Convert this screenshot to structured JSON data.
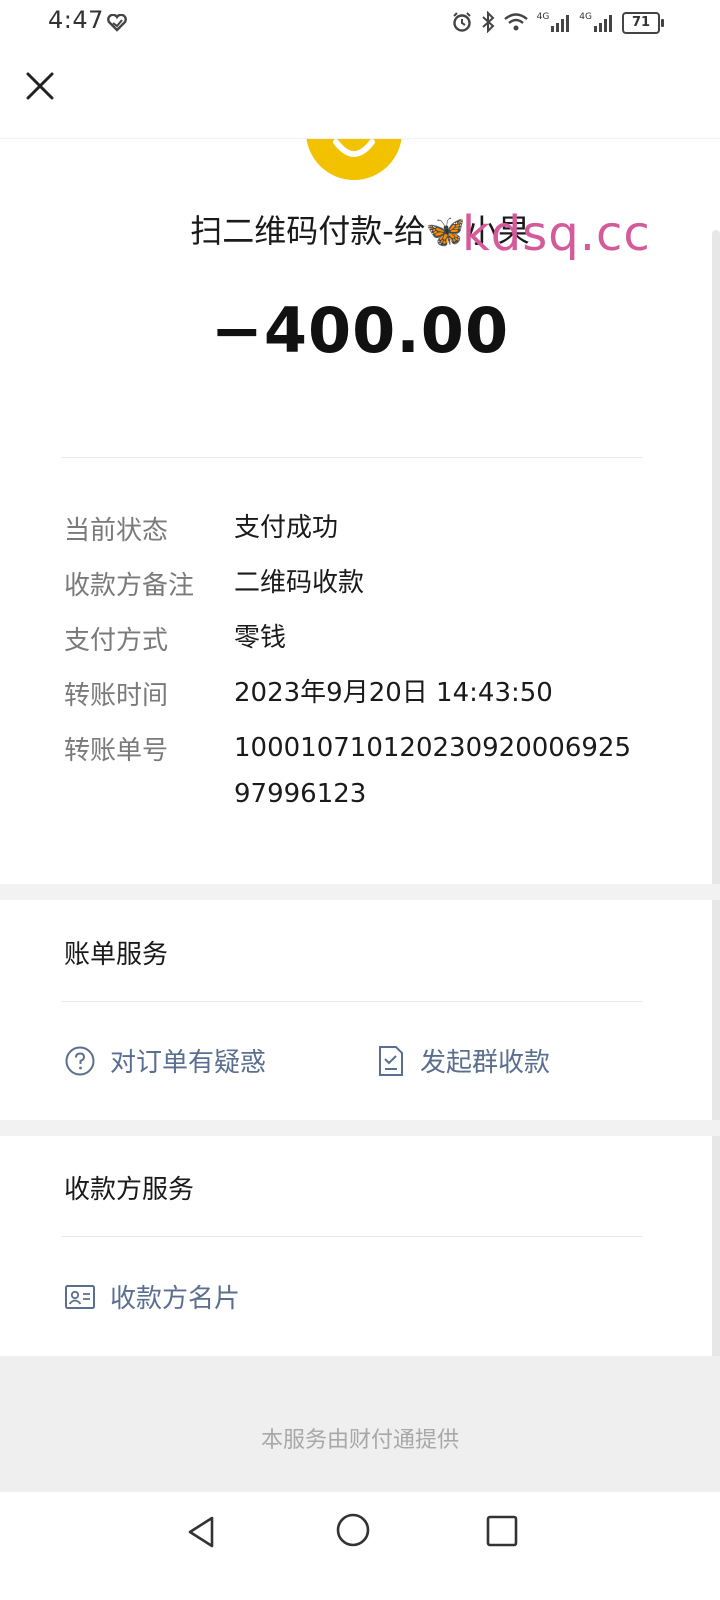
{
  "status_bar": {
    "time": "4:47",
    "battery": "71",
    "signal_1": "4G",
    "signal_2": "4G"
  },
  "header": {
    "close_icon": "close-icon"
  },
  "payment": {
    "title_prefix": "扫二维码付款-给",
    "title_emoji": "🦋",
    "title_suffix": "小果",
    "amount": "−400.00"
  },
  "watermark": "kdsq.cc",
  "details": [
    {
      "label": "当前状态",
      "value": "支付成功"
    },
    {
      "label": "收款方备注",
      "value": "二维码收款"
    },
    {
      "label": "支付方式",
      "value": "零钱"
    },
    {
      "label": "转账时间",
      "value": "2023年9月20日 14:43:50"
    },
    {
      "label": "转账单号",
      "value": "10001071012023092000692597996123"
    }
  ],
  "bill_service": {
    "title": "账单服务",
    "question_link": "对订单有疑惑",
    "group_collect_link": "发起群收款"
  },
  "payee_service": {
    "title": "收款方服务",
    "card_link": "收款方名片"
  },
  "footer": {
    "text": "本服务由财付通提供"
  },
  "colors": {
    "avatar": "#f2c200",
    "link": "#5a6f8f",
    "watermark": "#d45a9a"
  }
}
